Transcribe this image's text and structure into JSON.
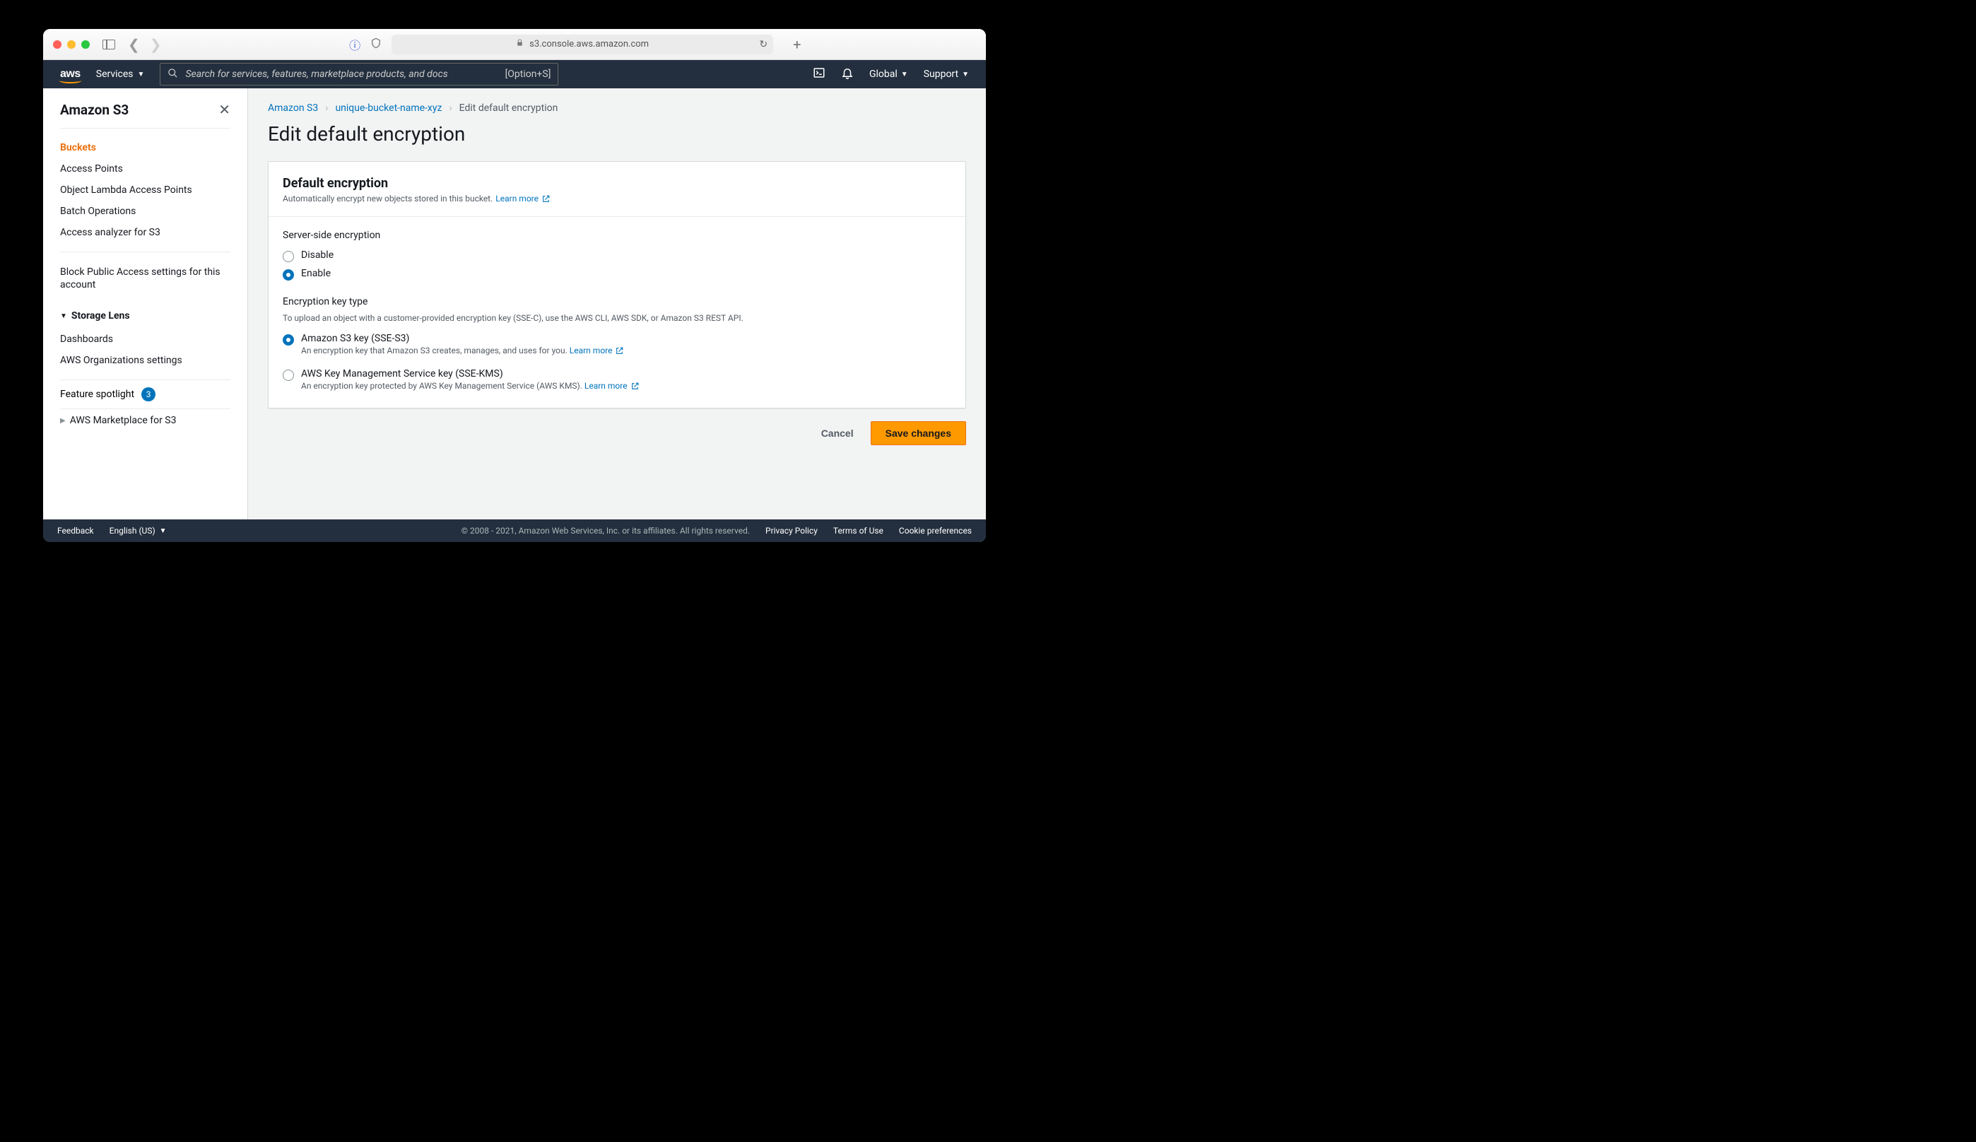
{
  "browser": {
    "url_host": "s3.console.aws.amazon.com"
  },
  "header": {
    "services_label": "Services",
    "search_placeholder": "Search for services, features, marketplace products, and docs",
    "search_shortcut": "[Option+S]",
    "region_label": "Global",
    "support_label": "Support"
  },
  "sidebar": {
    "title": "Amazon S3",
    "groups": [
      {
        "items": [
          "Buckets",
          "Access Points",
          "Object Lambda Access Points",
          "Batch Operations",
          "Access analyzer for S3"
        ],
        "active_index": 0
      },
      {
        "items": [
          "Block Public Access settings for this account"
        ]
      }
    ],
    "section": {
      "title": "Storage Lens",
      "items": [
        "Dashboards",
        "AWS Organizations settings"
      ]
    },
    "feature_spotlight": {
      "label": "Feature spotlight",
      "badge": "3"
    },
    "marketplace": {
      "label": "AWS Marketplace for S3"
    }
  },
  "breadcrumb": {
    "root": "Amazon S3",
    "bucket": "unique-bucket-name-xyz",
    "current": "Edit default encryption"
  },
  "page": {
    "title": "Edit default encryption",
    "panel_title": "Default encryption",
    "panel_desc": "Automatically encrypt new objects stored in this bucket.",
    "learn_more": "Learn more",
    "sse_label": "Server-side encryption",
    "sse_options": {
      "disable": "Disable",
      "enable": "Enable",
      "selected": "enable"
    },
    "keytype_label": "Encryption key type",
    "keytype_hint": "To upload an object with a customer-provided encryption key (SSE-C), use the AWS CLI, AWS SDK, or Amazon S3 REST API.",
    "keytype_options": [
      {
        "title": "Amazon S3 key (SSE-S3)",
        "desc": "An encryption key that Amazon S3 creates, manages, and uses for you.",
        "learn_more": "Learn more"
      },
      {
        "title": "AWS Key Management Service key (SSE-KMS)",
        "desc": "An encryption key protected by AWS Key Management Service (AWS KMS).",
        "learn_more": "Learn more"
      }
    ],
    "keytype_selected": 0,
    "cancel": "Cancel",
    "save": "Save changes"
  },
  "footer": {
    "feedback": "Feedback",
    "language": "English (US)",
    "copyright": "© 2008 - 2021, Amazon Web Services, Inc. or its affiliates. All rights reserved.",
    "privacy": "Privacy Policy",
    "terms": "Terms of Use",
    "cookie": "Cookie preferences"
  }
}
